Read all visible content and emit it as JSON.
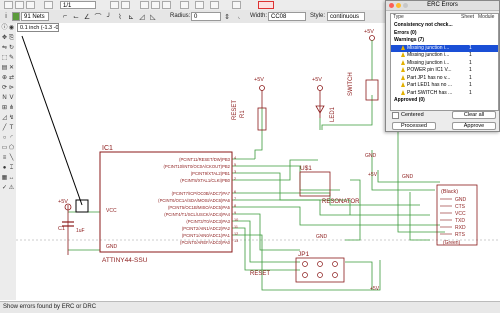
{
  "toolbar": {
    "sheet_value": "1/1",
    "layer_value": "91 Nets",
    "radius_label": "Radius:",
    "radius_value": "0",
    "width_label": "Width:",
    "width_value": "CC08",
    "style_label": "Style:",
    "style_value": "continuous",
    "grid_value": "1000"
  },
  "coord_readout": "0.1 inch (-1.3 -0.5)",
  "status_text": "Show errors found by ERC or DRC",
  "schematic": {
    "ic1_name": "IC1",
    "ic1_value": "ATTINY44-SSU",
    "vcc": "VCC",
    "gnd": "GND",
    "pins_right": [
      "(PCINT11/RESET/DW)PB3",
      "(PCINT10/INT0/OC0A/CKOUT)PB2",
      "(PCINT9/XTAL2)PB1",
      "(PCINT8/XTAL1/CLKI)PB0",
      "(PCINT7/ICP/OC0B/ADC7)PA7",
      "(PCINT6/OC1A/SDA/MOSI/ADC6)PA6",
      "(PCINT5/OC1B/MISO/ADC5)PA5",
      "(PCINT4/T1/SCL/USCK/ADC4)PA4",
      "(PCINT3/T0/ADC3)PA3",
      "(PCINT2/AIN1/ADC2)PA2",
      "(PCINT1/AIN0/ADC1)PA1",
      "(PCINT0/AREF/ADC0)PA0"
    ],
    "pin_nums": [
      "4",
      "5",
      "3",
      "2",
      "6",
      "7",
      "8",
      "9",
      "10",
      "11",
      "12",
      "13"
    ],
    "u1": "U$1",
    "resonator": "RESONATOR",
    "reset_sym": "RESET",
    "r1": "R1",
    "led1": "LED1",
    "switch": "SWITCH",
    "jp1": "JP1",
    "ftdi": "(Black)",
    "ftdi_pins": [
      "GND",
      "CTS",
      "VCC",
      "TXD",
      "RXD",
      "RTS"
    ],
    "ftdi_bottom": "(Green)",
    "c1": "C1",
    "c1_val": "1uF",
    "plus5v": "+5V"
  },
  "erc": {
    "title": "ERC Errors",
    "col_type": "Type",
    "col_sheet": "Sheet",
    "col_module": "Module",
    "rows": [
      {
        "text": "Consistency not check...",
        "sheet": "",
        "bold": true
      },
      {
        "text": "Errors (0)",
        "sheet": "",
        "bold": true
      },
      {
        "text": "Warnings (7)",
        "sheet": "",
        "bold": true
      },
      {
        "text": "Missing junction i...",
        "sheet": "1",
        "warn": true,
        "selected": true
      },
      {
        "text": "Missing junction i...",
        "sheet": "1",
        "warn": true
      },
      {
        "text": "Missing junction i...",
        "sheet": "1",
        "warn": true
      },
      {
        "text": "POWER pin IC1 V...",
        "sheet": "1",
        "warn": true
      },
      {
        "text": "Part JP1 has no v...",
        "sheet": "1",
        "warn": true
      },
      {
        "text": "Part LED1 has no ...",
        "sheet": "1",
        "warn": true
      },
      {
        "text": "Part SWITCH has ...",
        "sheet": "1",
        "warn": true
      },
      {
        "text": "Approved (0)",
        "sheet": "",
        "bold": true
      }
    ],
    "centered_label": "Centered",
    "clear_all_label": "Clear all",
    "processed_label": "Processed",
    "approve_label": "Approve"
  }
}
